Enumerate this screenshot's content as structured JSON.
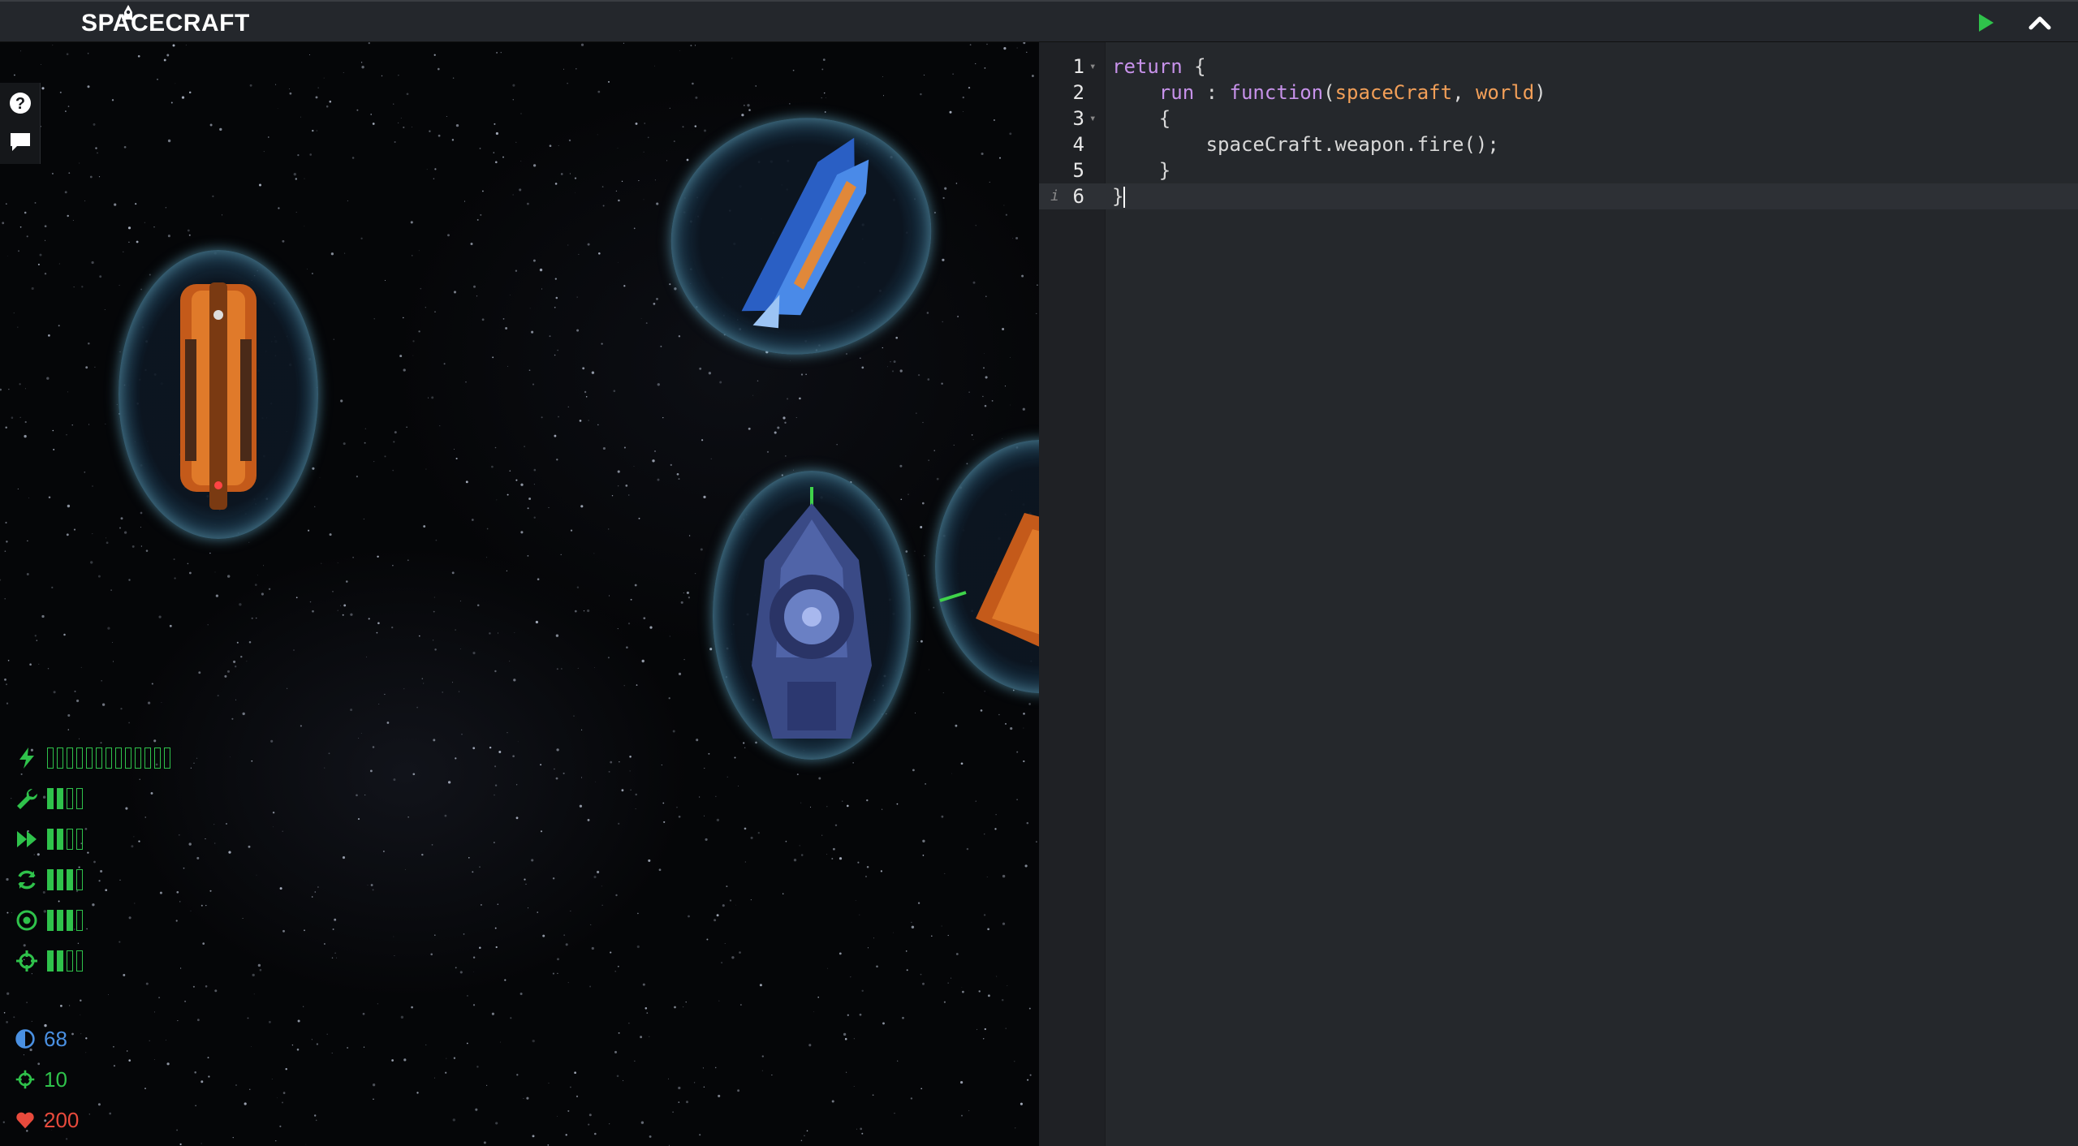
{
  "app": {
    "title": "SPACECRAFT"
  },
  "toolbar": {
    "run_icon": "play-icon",
    "collapse_icon": "chevron-up-icon",
    "run_color": "#2fc24b"
  },
  "side_tools": [
    {
      "name": "help",
      "icon": "question-circle-icon"
    },
    {
      "name": "chat",
      "icon": "comment-icon"
    }
  ],
  "stats": [
    {
      "icon": "bolt-icon",
      "filled": 0,
      "total": 13
    },
    {
      "icon": "wrench-icon",
      "filled": 2,
      "total": 4
    },
    {
      "icon": "fast-forward-icon",
      "filled": 2,
      "total": 4
    },
    {
      "icon": "refresh-icon",
      "filled": 3,
      "total": 4
    },
    {
      "icon": "target-icon",
      "filled": 3,
      "total": 4
    },
    {
      "icon": "crosshair-icon",
      "filled": 2,
      "total": 4
    }
  ],
  "resources": [
    {
      "icon": "shield-half-icon",
      "value": "68",
      "color": "#4a90e2"
    },
    {
      "icon": "crosshair-icon",
      "value": "10",
      "color": "#2fc24b"
    },
    {
      "icon": "heart-icon",
      "value": "200",
      "color": "#e84a3c"
    }
  ],
  "editor": {
    "lines": [
      {
        "number": "1",
        "fold": true,
        "text": "return {"
      },
      {
        "number": "2",
        "fold": false,
        "text": "    run : function(spaceCraft, world)"
      },
      {
        "number": "3",
        "fold": true,
        "text": "    {"
      },
      {
        "number": "4",
        "fold": false,
        "text": "        spaceCraft.weapon.fire();"
      },
      {
        "number": "5",
        "fold": false,
        "text": "    }"
      },
      {
        "number": "6",
        "fold": false,
        "text": "}"
      }
    ],
    "active_line": 6
  }
}
